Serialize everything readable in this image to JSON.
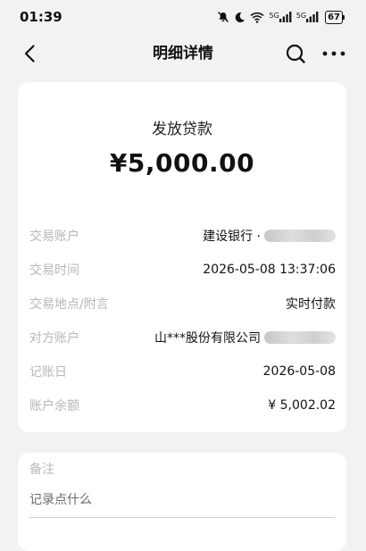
{
  "status_bar": {
    "time": "01:39",
    "sig1_tag": "5G",
    "sig2_tag": "5G",
    "battery": "67"
  },
  "nav": {
    "title": "明细详情"
  },
  "transaction": {
    "type": "发放贷款",
    "amount": "¥5,000.00"
  },
  "details": [
    {
      "label": "交易账户",
      "value": "建设银行 ·"
    },
    {
      "label": "交易时间",
      "value": "2026-05-08 13:37:06"
    },
    {
      "label": "交易地点/附言",
      "value": "实时付款"
    },
    {
      "label": "对方账户",
      "value": "山***股份有限公司"
    },
    {
      "label": "记账日",
      "value": "2026-05-08"
    },
    {
      "label": "账户余额",
      "value": "¥ 5,002.02"
    }
  ],
  "note": {
    "label": "备注",
    "placeholder": "记录点什么"
  }
}
